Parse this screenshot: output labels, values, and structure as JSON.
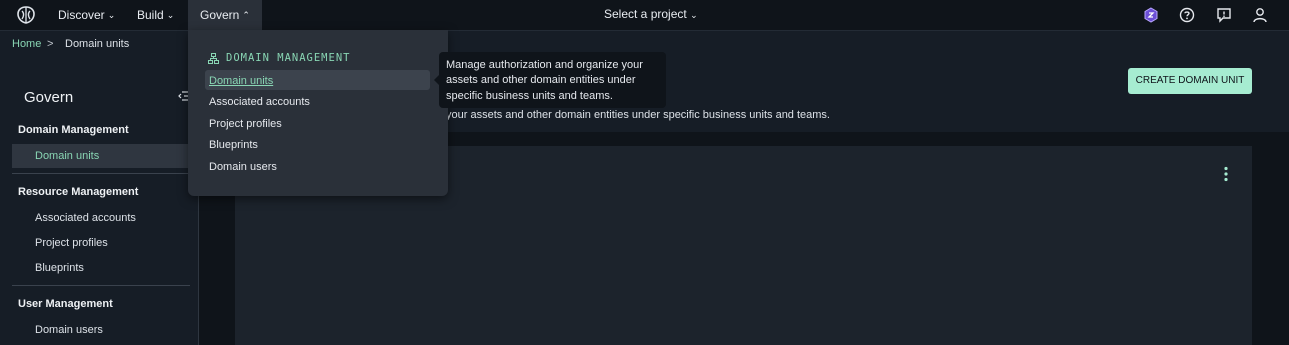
{
  "topnav": {
    "discover": "Discover",
    "build": "Build",
    "govern": "Govern",
    "project_selector": "Select a project"
  },
  "breadcrumb": {
    "home": "Home",
    "separator": ">",
    "current": "Domain units"
  },
  "sidebar": {
    "title": "Govern",
    "sections": [
      {
        "title": "Domain Management",
        "items": [
          "Domain units"
        ]
      },
      {
        "title": "Resource Management",
        "items": [
          "Associated accounts",
          "Project profiles",
          "Blueprints"
        ]
      },
      {
        "title": "User Management",
        "items": [
          "Domain users"
        ]
      }
    ]
  },
  "main": {
    "create_button": "CREATE DOMAIN UNIT",
    "description": "your assets and other domain entities under specific business units and teams."
  },
  "dropdown": {
    "header": "DOMAIN MANAGEMENT",
    "items": [
      "Domain units",
      "Associated accounts",
      "Project profiles",
      "Blueprints",
      "Domain users"
    ]
  },
  "tooltip": {
    "lines": [
      "Manage authorization and organize your",
      "assets and other domain entities under",
      "specific business units and teams."
    ]
  },
  "colors": {
    "accent": "#89d6b4",
    "button": "#a6ecd1",
    "background": "#0f141a",
    "panel": "#1c232c",
    "dropdown": "#2a3039"
  },
  "icons": [
    "app-logo-icon",
    "chevron-down-icon",
    "chevron-up-icon",
    "hexagon-badge-icon",
    "help-icon",
    "feedback-icon",
    "user-icon",
    "collapse-panel-icon",
    "hierarchy-icon",
    "kebab-menu-icon"
  ]
}
